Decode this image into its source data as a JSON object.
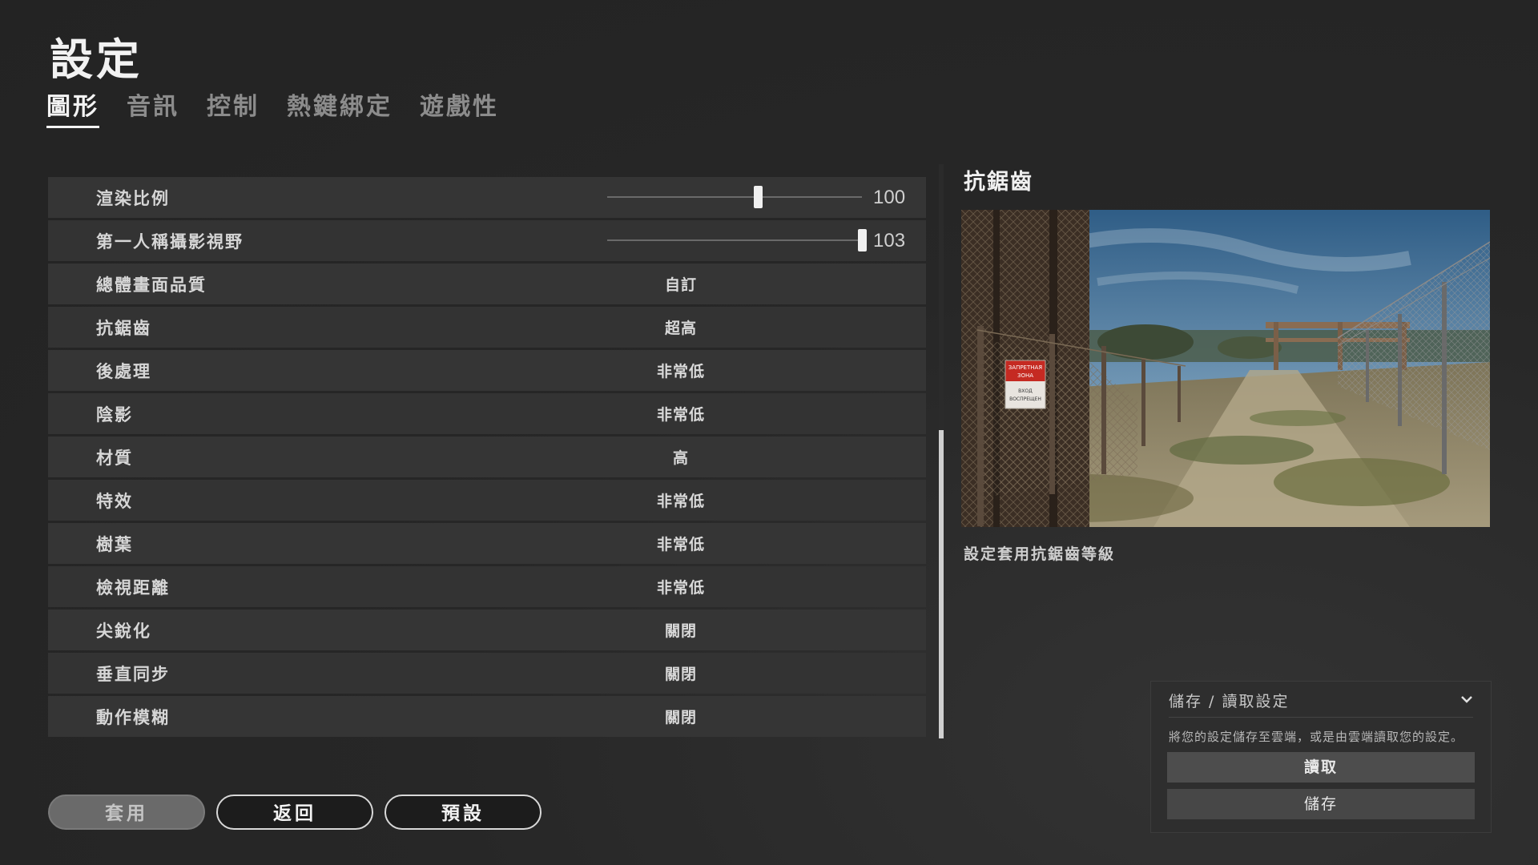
{
  "header": {
    "title": "設定"
  },
  "tabs": [
    {
      "label": "圖形",
      "active": true
    },
    {
      "label": "音訊",
      "active": false
    },
    {
      "label": "控制",
      "active": false
    },
    {
      "label": "熱鍵綁定",
      "active": false
    },
    {
      "label": "遊戲性",
      "active": false
    }
  ],
  "settings": {
    "render_scale": {
      "label": "渲染比例",
      "value": "100",
      "fraction": 0.59
    },
    "fov": {
      "label": "第一人稱攝影視野",
      "value": "103",
      "fraction": 1.0
    },
    "rows": [
      {
        "label": "總體畫面品質",
        "value": "自訂"
      },
      {
        "label": "抗鋸齒",
        "value": "超高"
      },
      {
        "label": "後處理",
        "value": "非常低"
      },
      {
        "label": "陰影",
        "value": "非常低"
      },
      {
        "label": "材質",
        "value": "高"
      },
      {
        "label": "特效",
        "value": "非常低"
      },
      {
        "label": "樹葉",
        "value": "非常低"
      },
      {
        "label": "檢視距離",
        "value": "非常低"
      },
      {
        "label": "尖銳化",
        "value": "關閉"
      },
      {
        "label": "垂直同步",
        "value": "關閉"
      },
      {
        "label": "動作模糊",
        "value": "關閉"
      }
    ]
  },
  "preview": {
    "title": "抗鋸齒",
    "description": "設定套用抗鋸齒等級",
    "sign_lines": [
      "ЗАПРЕТНАЯ",
      "ЗОНА",
      "ВХОД",
      "ВОСПРЕЩЕН"
    ]
  },
  "panel": {
    "title": "儲存 / 讀取設定",
    "description": "將您的設定儲存至雲端，或是由雲端讀取您的設定。",
    "load_label": "讀取",
    "save_label": "儲存"
  },
  "buttons": {
    "apply": "套用",
    "back": "返回",
    "default": "預設"
  },
  "colors": {
    "background": "#262626",
    "row": "#343434",
    "accent": "#f0f0f0"
  }
}
